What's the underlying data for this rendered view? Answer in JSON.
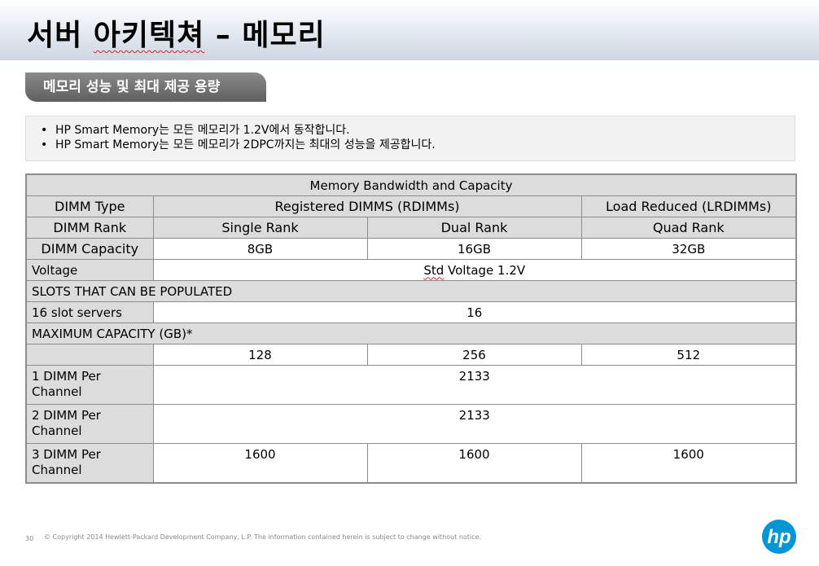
{
  "header": {
    "title_part1": "서버 ",
    "title_part2": "아키텍쳐",
    "title_part3": " – 메모리"
  },
  "section_tag": "메모리 성능 및 최대 제공 용량",
  "bullets": [
    "HP Smart Memory는 모든 메모리가 1.2V에서 동작합니다.",
    "HP Smart Memory는 모든 메모리가 2DPC까지는 최대의 성능을 제공합니다."
  ],
  "table": {
    "caption": "Memory Bandwidth and Capacity",
    "dimm_type_label": "DIMM Type",
    "rdimm_label": "Registered DIMMS (RDIMMs)",
    "lrdimm_label": "Load Reduced (LRDIMMs)",
    "dimm_rank_label": "DIMM Rank",
    "rank_single": "Single Rank",
    "rank_dual": "Dual Rank",
    "rank_quad": "Quad Rank",
    "capacity_label": "DIMM Capacity",
    "cap_single": "8GB",
    "cap_dual": "16GB",
    "cap_quad": "32GB",
    "voltage_label": "Voltage",
    "voltage_std": "Std",
    "voltage_rest": " Voltage 1.2V",
    "slots_header": "SLOTS THAT CAN BE POPULATED",
    "slot_servers_label": "16 slot servers",
    "slot_servers_value": "16",
    "max_cap_header": "MAXIMUM CAPACITY (GB)*",
    "max_single": "128",
    "max_dual": "256",
    "max_quad": "512",
    "dpc1_label": "1 DIMM Per Channel",
    "dpc1_value": "2133",
    "dpc2_label": "2 DIMM Per Channel",
    "dpc2_value": "2133",
    "dpc3_label": "3 DIMM Per Channel",
    "dpc3_single": "1600",
    "dpc3_dual": "1600",
    "dpc3_quad": "1600"
  },
  "footer": {
    "page_number": "30",
    "copyright": "© Copyright 2014 Hewlett-Packard Development Company, L.P. The information contained herein is subject to change without notice.",
    "logo_text": "hp",
    "brand_color": "#0096d6"
  }
}
